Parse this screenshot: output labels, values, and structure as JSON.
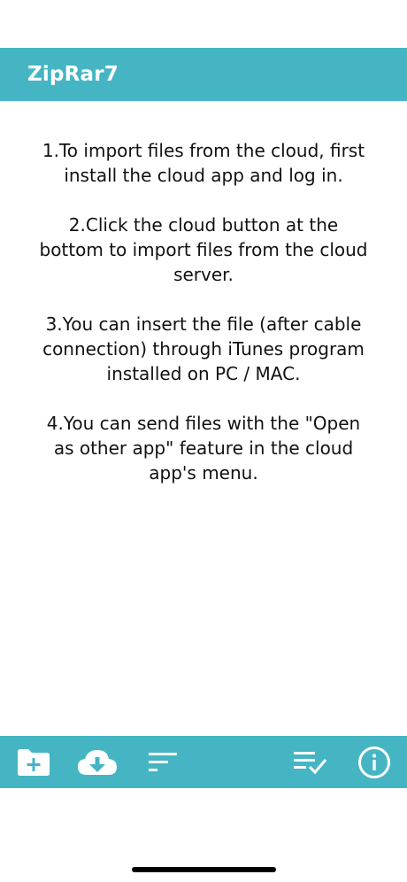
{
  "app": {
    "title": "ZipRar7"
  },
  "instructions": [
    "1.To import files from the cloud, first install the cloud app and log in.",
    "2.Click the cloud button at the bottom to import files from the cloud server.",
    "3.You can insert the file (after cable connection) through iTunes program installed on PC / MAC.",
    "4.You can send files with the \"Open as other app\" feature in the cloud app's menu."
  ],
  "toolbar": {
    "icons": [
      "new-folder-icon",
      "cloud-download-icon",
      "sort-icon",
      "select-list-icon",
      "info-icon"
    ]
  },
  "colors": {
    "accent": "#45b5c4",
    "text": "#111111",
    "icon": "#ffffff"
  }
}
